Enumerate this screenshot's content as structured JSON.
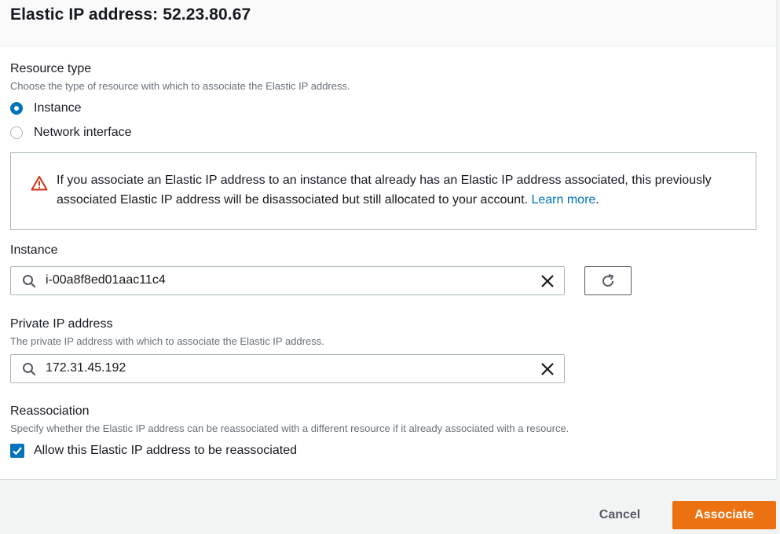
{
  "header": {
    "title": "Elastic IP address: 52.23.80.67"
  },
  "resource_type": {
    "label": "Resource type",
    "description": "Choose the type of resource with which to associate the Elastic IP address.",
    "options": [
      {
        "label": "Instance",
        "selected": true
      },
      {
        "label": "Network interface",
        "selected": false
      }
    ]
  },
  "alert": {
    "text": "If you associate an Elastic IP address to an instance that already has an Elastic IP address associated, this previously associated Elastic IP address will be disassociated but still allocated to your account. ",
    "link": "Learn more",
    "trailing": ".",
    "icon": "warning-icon"
  },
  "instance": {
    "label": "Instance",
    "value": "i-00a8f8ed01aac11c4"
  },
  "private_ip": {
    "label": "Private IP address",
    "description": "The private IP address with which to associate the Elastic IP address.",
    "value": "172.31.45.192"
  },
  "reassociation": {
    "label": "Reassociation",
    "description": "Specify whether the Elastic IP address can be reassociated with a different resource if it already associated with a resource.",
    "checkbox_label": "Allow this Elastic IP address to be reassociated",
    "checked": true
  },
  "footer": {
    "cancel_label": "Cancel",
    "associate_label": "Associate"
  },
  "colors": {
    "primary": "#ec7211",
    "link": "#0073bb",
    "warning": "#d13212"
  }
}
